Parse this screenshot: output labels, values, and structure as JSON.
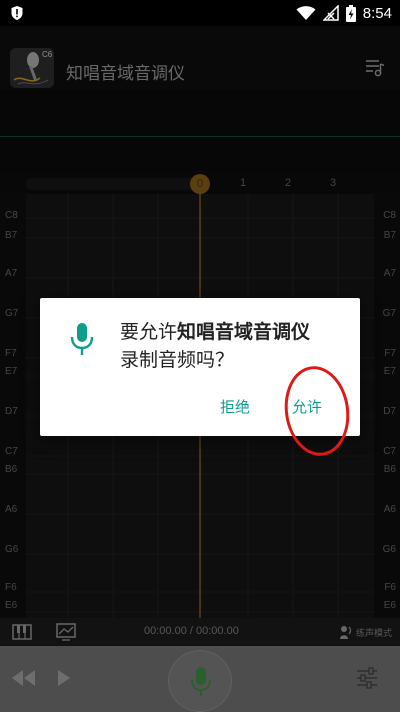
{
  "status_bar": {
    "time": "8:54",
    "icons": [
      "alert-icon",
      "wifi-icon",
      "signal-icon",
      "battery-icon"
    ]
  },
  "header": {
    "title": "知唱音域音调仪",
    "logo_note": "C6",
    "icons": [
      "app-logo-icon",
      "playlist-icon"
    ]
  },
  "ruler": {
    "labels": [
      "0",
      "1",
      "2",
      "3"
    ]
  },
  "note_labels": [
    "C8",
    "B7",
    "A7",
    "G7",
    "F7",
    "E7",
    "D7",
    "C7",
    "B6",
    "A6",
    "G6",
    "F6",
    "E6"
  ],
  "transport": {
    "time": "00:00.00 / 00:00.00",
    "mode_label": "练声模式"
  },
  "dialog": {
    "message_prefix": "要允许",
    "app_name": "知唱音域音调仪",
    "message_suffix": "录制音频吗？",
    "deny_label": "拒绝",
    "allow_label": "允许"
  },
  "colors": {
    "accent": "#0f9d8c",
    "playhead": "#a4741e",
    "annotation": "#e01818",
    "record_mic": "#4caf50"
  }
}
